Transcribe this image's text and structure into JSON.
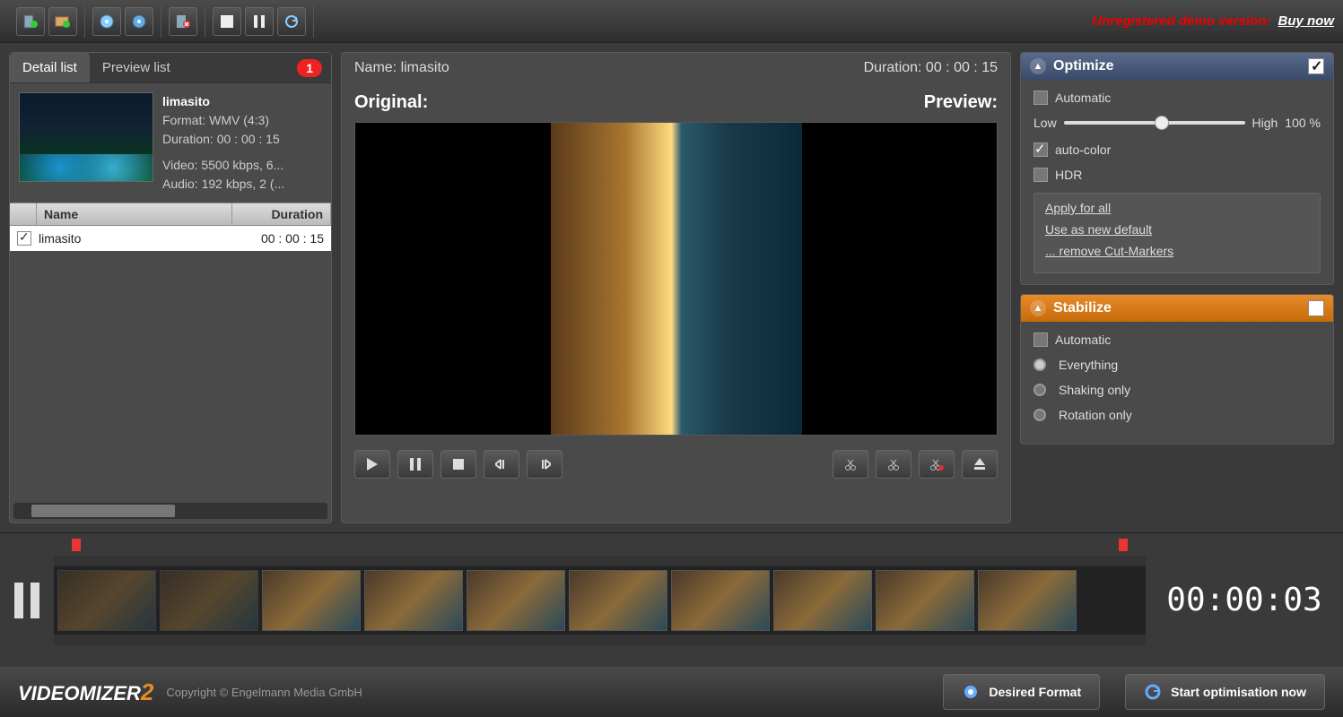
{
  "toolbar": {
    "demo_text": "Unregistered demo version:",
    "buy_link": "Buy now"
  },
  "tabs": {
    "detail": "Detail list",
    "preview": "Preview list",
    "badge": "1"
  },
  "clip": {
    "title": "limasito",
    "format": "Format: WMV (4:3)",
    "duration": "Duration: 00 : 00 : 15",
    "video": "Video: 5500 kbps, 6...",
    "audio": "Audio: 192 kbps, 2 (..."
  },
  "list": {
    "col_name": "Name",
    "col_duration": "Duration",
    "rows": [
      {
        "name": "limasito",
        "duration": "00 : 00 : 15",
        "checked": true
      }
    ]
  },
  "center": {
    "name_label": "Name: limasito",
    "duration_label": "Duration: 00 : 00 : 15",
    "original_label": "Original:",
    "preview_label": "Preview:"
  },
  "optimize": {
    "title": "Optimize",
    "enabled": true,
    "automatic_label": "Automatic",
    "automatic_checked": false,
    "slider_low": "Low",
    "slider_high": "High",
    "slider_value": "100  %",
    "autocolor_label": "auto-color",
    "autocolor_checked": true,
    "hdr_label": "HDR",
    "hdr_checked": false,
    "links": {
      "apply_all": "Apply for all",
      "use_default": "Use as new default",
      "remove_markers": "... remove Cut-Markers"
    }
  },
  "stabilize": {
    "title": "Stabilize",
    "enabled": false,
    "automatic_label": "Automatic",
    "opt_everything": "Everything",
    "opt_shaking": "Shaking only",
    "opt_rotation": "Rotation only"
  },
  "timeline": {
    "timecode": "00:00:03"
  },
  "footer": {
    "logo_a": "VIDEOMIZER",
    "logo_b": "2",
    "copyright": "Copyright © Engelmann Media GmbH",
    "desired_format": "Desired Format",
    "start_optimization": "Start optimisation now"
  }
}
